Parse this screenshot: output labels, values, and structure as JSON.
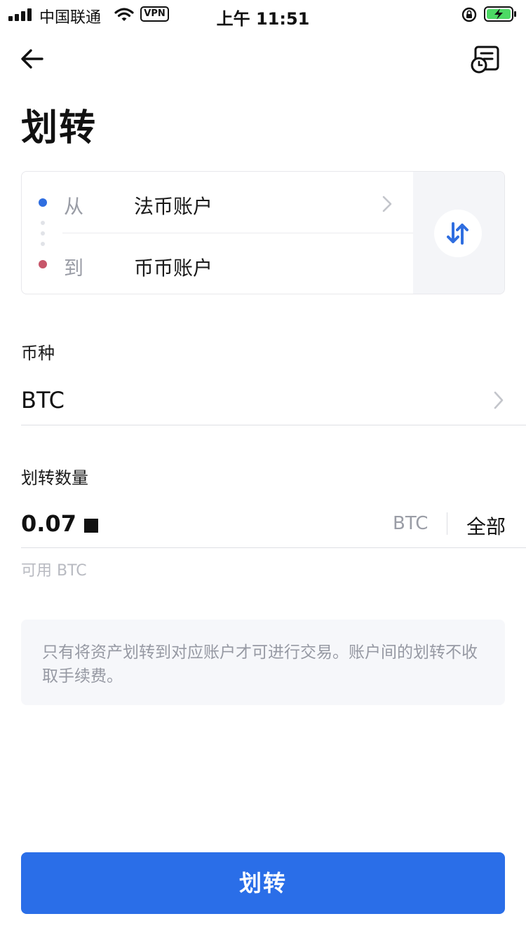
{
  "status_bar": {
    "carrier": "中国联通",
    "vpn": "VPN",
    "time": "上午 11:51"
  },
  "nav": {
    "back_icon": "arrow-left-icon",
    "record_icon": "transfer-history-icon"
  },
  "page": {
    "title": "划转"
  },
  "transfer": {
    "from_label": "从",
    "from_account": "法币账户",
    "to_label": "到",
    "to_account": "币币账户",
    "swap_icon": "swap-arrows-icon",
    "colors": {
      "from_dot": "#2f6ee0",
      "to_dot": "#c7566a",
      "swap_accent": "#2f6ee0"
    }
  },
  "currency": {
    "label": "币种",
    "value": "BTC"
  },
  "amount": {
    "label": "划转数量",
    "value": "0.07",
    "unit": "BTC",
    "all_label": "全部",
    "available": "可用 BTC"
  },
  "notice": {
    "text": "只有将资产划转到对应账户才可进行交易。账户间的划转不收取手续费。"
  },
  "actions": {
    "submit_label": "划转",
    "accent": "#2a6ee8"
  }
}
